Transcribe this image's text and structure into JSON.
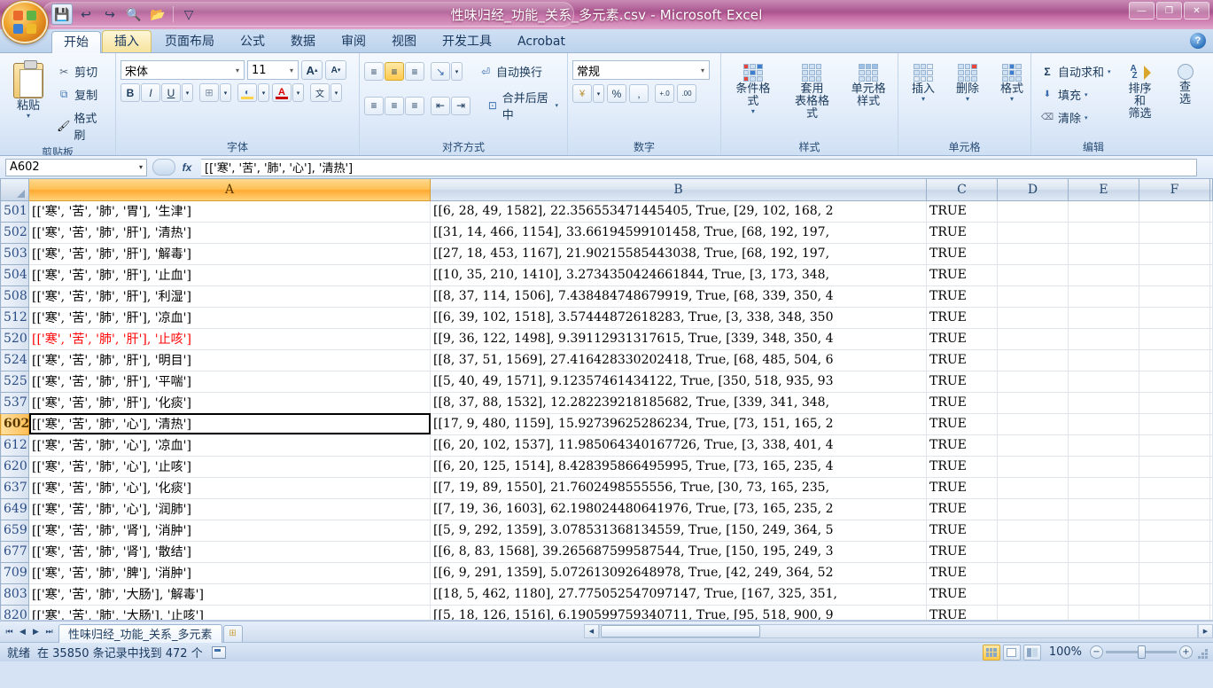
{
  "window": {
    "title": "性味归经_功能_关系_多元素.csv - Microsoft Excel",
    "minimize": "—",
    "maximize": "❐",
    "close": "✕"
  },
  "quick_access": {
    "save": "💾",
    "undo": "↩",
    "redo": "↪",
    "print_preview": "🔍",
    "open": "📂",
    "filter": "▽"
  },
  "tabs": [
    {
      "label": "开始",
      "state": "active"
    },
    {
      "label": "插入",
      "state": "hover"
    },
    {
      "label": "页面布局",
      "state": "normal"
    },
    {
      "label": "公式",
      "state": "normal"
    },
    {
      "label": "数据",
      "state": "normal"
    },
    {
      "label": "审阅",
      "state": "normal"
    },
    {
      "label": "视图",
      "state": "normal"
    },
    {
      "label": "开发工具",
      "state": "normal"
    },
    {
      "label": "Acrobat",
      "state": "normal"
    }
  ],
  "help_button": "?",
  "ribbon": {
    "clipboard": {
      "group_label": "剪贴板",
      "paste": "粘贴",
      "cut": "剪切",
      "copy": "复制",
      "format_painter": "格式刷",
      "cut_icon": "✂",
      "copy_icon": "⧉",
      "painter_icon": "🖌"
    },
    "font": {
      "group_label": "字体",
      "font_name": "宋体",
      "font_size": "11",
      "grow_font": "A",
      "shrink_font": "A",
      "bold": "B",
      "italic": "I",
      "underline": "U",
      "border": "⊞",
      "fill_color": "A",
      "font_color": "A",
      "phonetic": "文"
    },
    "alignment": {
      "group_label": "对齐方式",
      "align_top": "≡",
      "align_middle": "≡",
      "align_bottom": "≡",
      "orientation": "↘",
      "wrap_text": "自动换行",
      "align_left": "≡",
      "align_center": "≡",
      "align_right": "≡",
      "decrease_indent": "⇤",
      "increase_indent": "⇥",
      "merge_center": "合并后居中"
    },
    "number": {
      "group_label": "数字",
      "format": "常规",
      "accounting": "¥",
      "percent": "%",
      "comma": ",",
      "increase_decimal": "+.0",
      "decrease_decimal": ".00"
    },
    "styles": {
      "group_label": "样式",
      "conditional": "条件格式",
      "table_format_line1": "套用",
      "table_format_line2": "表格格式",
      "cell_styles_line1": "单元格",
      "cell_styles_line2": "样式"
    },
    "cells": {
      "group_label": "单元格",
      "insert": "插入",
      "delete": "删除",
      "format": "格式"
    },
    "editing": {
      "group_label": "编辑",
      "autosum": "自动求和",
      "fill": "填充",
      "clear": "清除",
      "sort_filter_line1": "排序和",
      "sort_filter_line2": "筛选",
      "find_select_line1": "查",
      "find_select_line2": "选",
      "sigma": "Σ",
      "fill_icon": "⬇",
      "clear_icon": "⌫",
      "sort_icon": "A\nZ"
    }
  },
  "formula_bar": {
    "name_box": "A602",
    "cancel": "✕",
    "accept": "✓",
    "fx": "fx",
    "value": "[['寒', '苦', '肺', '心'], '清热']"
  },
  "grid": {
    "columns": [
      {
        "label": "A",
        "selected": true
      },
      {
        "label": "B",
        "selected": false
      },
      {
        "label": "C",
        "selected": false
      },
      {
        "label": "D",
        "selected": false
      },
      {
        "label": "E",
        "selected": false
      },
      {
        "label": "F",
        "selected": false
      }
    ],
    "selected_cell": "A602",
    "rows": [
      {
        "n": "501",
        "a": "[['寒', '苦', '肺', '胃'], '生津']",
        "b": "[[6, 28, 49, 1582], 22.356553471445405, True, [29, 102, 168, 2",
        "c": "TRUE",
        "red": false,
        "selected": false
      },
      {
        "n": "502",
        "a": "[['寒', '苦', '肺', '肝'], '清热']",
        "b": "[[31, 14, 466, 1154], 33.66194599101458, True, [68, 192, 197,",
        "c": "TRUE",
        "red": false,
        "selected": false
      },
      {
        "n": "503",
        "a": "[['寒', '苦', '肺', '肝'], '解毒']",
        "b": "[[27, 18, 453, 1167], 21.90215585443038, True, [68, 192, 197,",
        "c": "TRUE",
        "red": false,
        "selected": false
      },
      {
        "n": "504",
        "a": "[['寒', '苦', '肺', '肝'], '止血']",
        "b": "[[10, 35, 210, 1410], 3.2734350424661844, True, [3, 173, 348,",
        "c": "TRUE",
        "red": false,
        "selected": false
      },
      {
        "n": "508",
        "a": "[['寒', '苦', '肺', '肝'], '利湿']",
        "b": "[[8, 37, 114, 1506], 7.438484748679919, True, [68, 339, 350, 4",
        "c": "TRUE",
        "red": false,
        "selected": false
      },
      {
        "n": "512",
        "a": "[['寒', '苦', '肺', '肝'], '凉血']",
        "b": "[[6, 39, 102, 1518], 3.57444872618283, True, [3, 338, 348, 350",
        "c": "TRUE",
        "red": false,
        "selected": false
      },
      {
        "n": "520",
        "a": "[['寒', '苦', '肺', '肝'], '止咳']",
        "b": "[[9, 36, 122, 1498], 9.39112931317615, True, [339, 348, 350, 4",
        "c": "TRUE",
        "red": true,
        "selected": false
      },
      {
        "n": "524",
        "a": "[['寒', '苦', '肺', '肝'], '明目']",
        "b": "[[8, 37, 51, 1569], 27.416428330202418, True, [68, 485, 504, 6",
        "c": "TRUE",
        "red": false,
        "selected": false
      },
      {
        "n": "525",
        "a": "[['寒', '苦', '肺', '肝'], '平喘']",
        "b": "[[5, 40, 49, 1571], 9.12357461434122, True, [350, 518, 935, 93",
        "c": "TRUE",
        "red": false,
        "selected": false
      },
      {
        "n": "537",
        "a": "[['寒', '苦', '肺', '肝'], '化痰']",
        "b": "[[8, 37, 88, 1532], 12.282239218185682, True, [339, 341, 348,",
        "c": "TRUE",
        "red": false,
        "selected": false
      },
      {
        "n": "602",
        "a": "[['寒', '苦', '肺', '心'], '清热']",
        "b": "[[17, 9, 480, 1159], 15.92739625286234, True, [73, 151, 165, 2",
        "c": "TRUE",
        "red": false,
        "selected": true
      },
      {
        "n": "612",
        "a": "[['寒', '苦', '肺', '心'], '凉血']",
        "b": "[[6, 20, 102, 1537], 11.985064340167726, True, [3, 338, 401, 4",
        "c": "TRUE",
        "red": false,
        "selected": false
      },
      {
        "n": "620",
        "a": "[['寒', '苦', '肺', '心'], '止咳']",
        "b": "[[6, 20, 125, 1514], 8.428395866495995, True, [73, 165, 235, 4",
        "c": "TRUE",
        "red": false,
        "selected": false
      },
      {
        "n": "637",
        "a": "[['寒', '苦', '肺', '心'], '化痰']",
        "b": "[[7, 19, 89, 1550], 21.7602498555556, True, [30, 73, 165, 235,",
        "c": "TRUE",
        "red": false,
        "selected": false
      },
      {
        "n": "649",
        "a": "[['寒', '苦', '肺', '心'], '润肺']",
        "b": "[[7, 19, 36, 1603], 62.198024480641976, True, [73, 165, 235, 2",
        "c": "TRUE",
        "red": false,
        "selected": false
      },
      {
        "n": "659",
        "a": "[['寒', '苦', '肺', '肾'], '消肿']",
        "b": "[[5, 9, 292, 1359], 3.078531368134559, True, [150, 249, 364, 5",
        "c": "TRUE",
        "red": false,
        "selected": false
      },
      {
        "n": "677",
        "a": "[['寒', '苦', '肺', '肾'], '散结']",
        "b": "[[6, 8, 83, 1568], 39.265687599587544, True, [150, 195, 249, 3",
        "c": "TRUE",
        "red": false,
        "selected": false
      },
      {
        "n": "709",
        "a": "[['寒', '苦', '肺', '脾'], '消肿']",
        "b": "[[6, 9, 291, 1359], 5.072613092648978, True, [42, 249, 364, 52",
        "c": "TRUE",
        "red": false,
        "selected": false
      },
      {
        "n": "803",
        "a": "[['寒', '苦', '肺', '大肠'], '解毒']",
        "b": "[[18, 5, 462, 1180], 27.775052547097147, True, [167, 325, 351,",
        "c": "TRUE",
        "red": false,
        "selected": false
      },
      {
        "n": "820",
        "a": "[['寒', '苦', '肺', '大肠'], '止咳']",
        "b": "[[5, 18, 126, 1516], 6.190599759340711, True, [95, 518, 900, 9",
        "c": "TRUE",
        "red": false,
        "selected": false
      }
    ]
  },
  "sheet_tabs": {
    "first": "⏮",
    "prev": "◀",
    "next": "▶",
    "last": "⏭",
    "active_sheet": "性味归经_功能_关系_多元素",
    "new_sheet": "⊞"
  },
  "status_bar": {
    "state": "就绪",
    "find_result": "在 35850 条记录中找到 472 个",
    "zoom": "100%",
    "zoom_out": "−",
    "zoom_in": "+",
    "view_normal": "normal-view",
    "view_layout": "page-layout-view",
    "view_break": "page-break-view"
  }
}
